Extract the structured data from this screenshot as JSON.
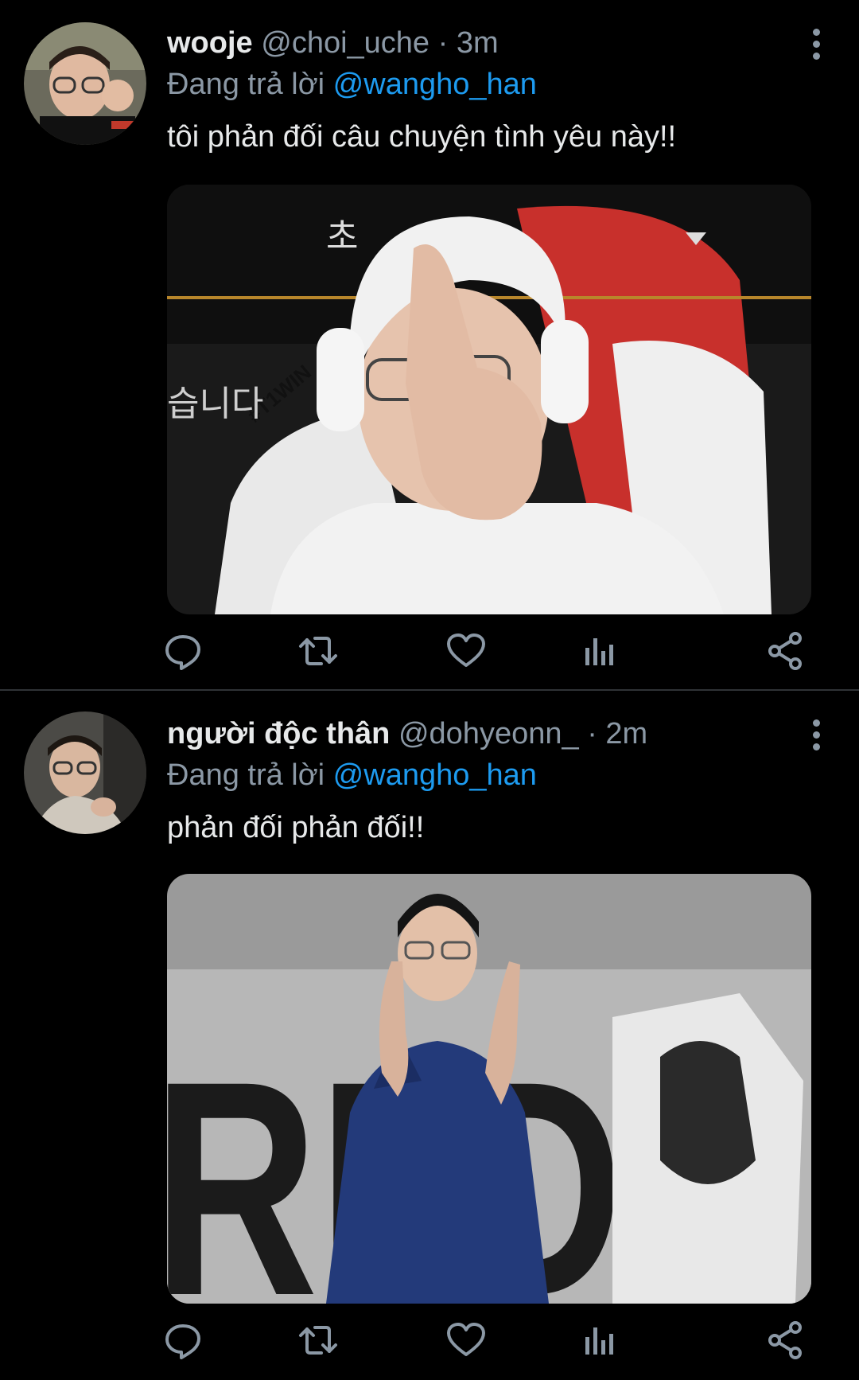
{
  "tweets": [
    {
      "name": "wooje",
      "handle": "@choi_uche",
      "separator": "·",
      "time": "3m",
      "reply_prefix": "Đang trả lời",
      "reply_to": "@wangho_han",
      "text": "tôi phản đối câu chuyện tình yêu này!!",
      "media_overlay": [
        "초",
        "습니다",
        "#T1WIN"
      ]
    },
    {
      "name": "người độc thân",
      "handle": "@dohyeonn_",
      "separator": "·",
      "time": "2m",
      "reply_prefix": "Đang trả lời",
      "reply_to": "@wangho_han",
      "text": "phản đối phản đối!!",
      "media_overlay": [
        "RLD"
      ]
    }
  ],
  "icons": [
    "comment-icon",
    "retweet-icon",
    "like-icon",
    "views-icon",
    "share-icon",
    "more-icon"
  ],
  "colors": {
    "background": "#000000",
    "accent": "#1d9bf0",
    "secondary_text": "#8b98a5",
    "divider": "#2f3336"
  }
}
